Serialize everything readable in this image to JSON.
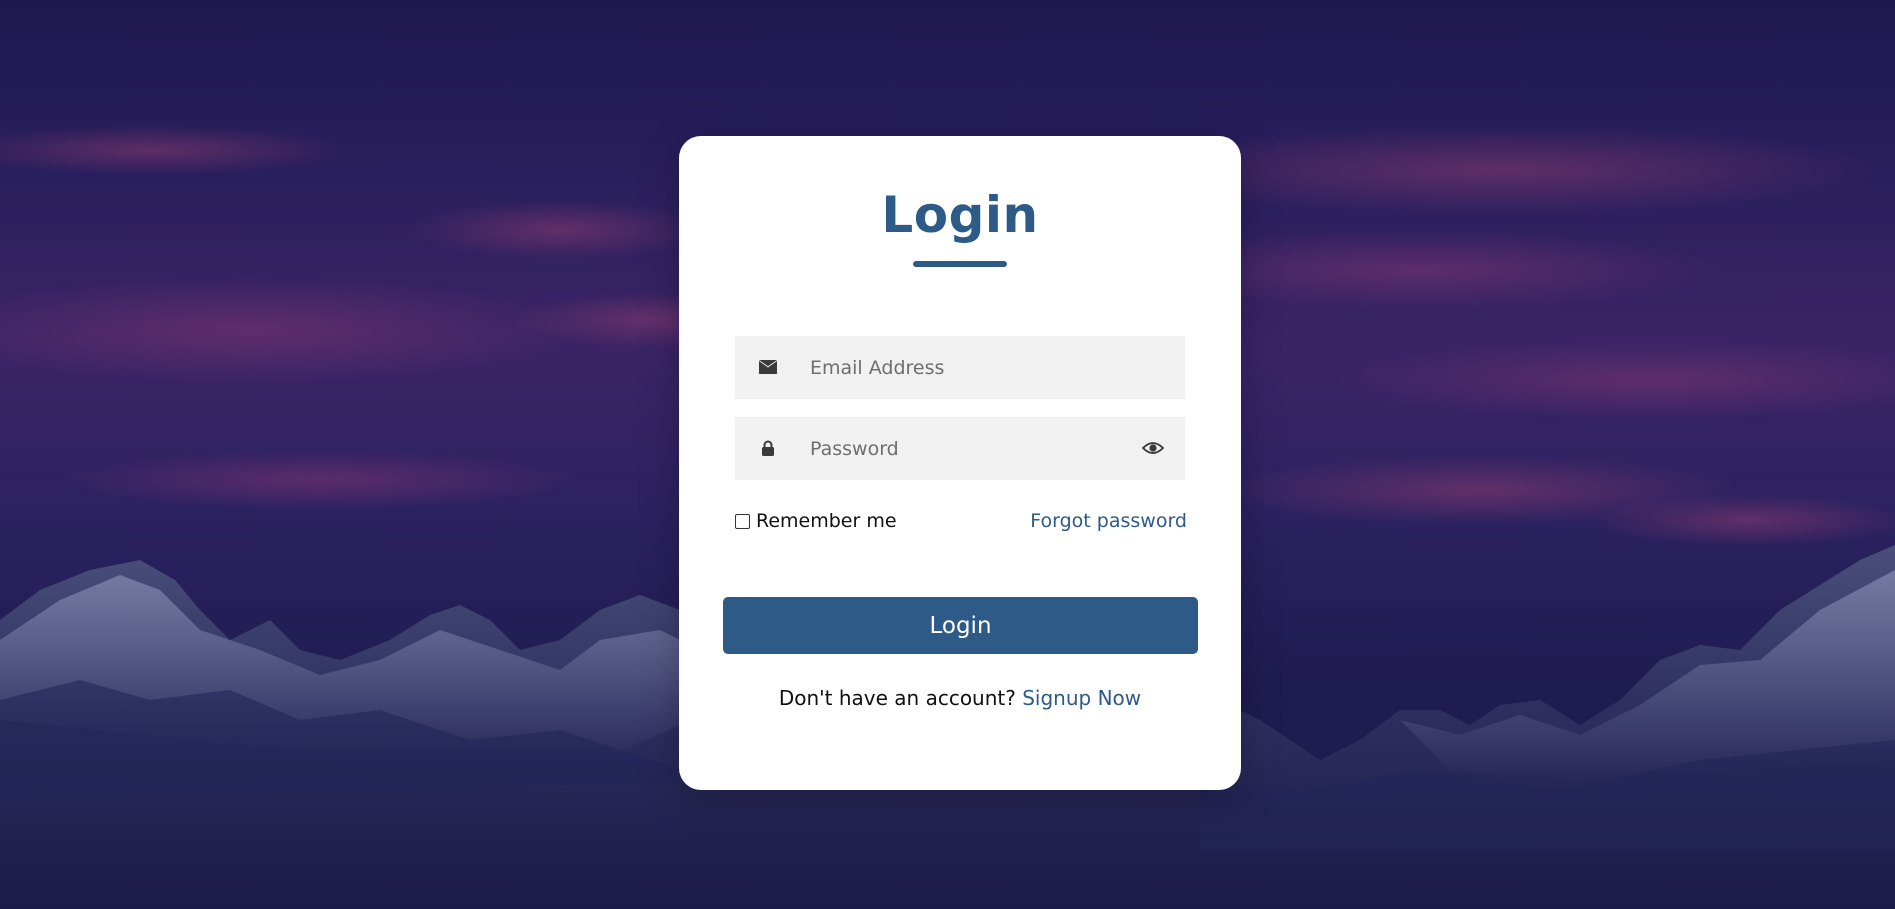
{
  "page": {
    "background_accent": "#3b2466"
  },
  "login_card": {
    "title": "Login",
    "accent_color": "#2e5a87",
    "email": {
      "icon": "envelope-icon",
      "placeholder": "Email Address",
      "value": ""
    },
    "password": {
      "icon": "lock-icon",
      "placeholder": "Password",
      "value": "",
      "toggle_icon": "eye-icon"
    },
    "remember_me": {
      "label": "Remember me",
      "checked": false
    },
    "forgot_password_label": "Forgot password",
    "login_button_label": "Login",
    "signup_prompt": "Don't have an account?",
    "signup_link_label": "Signup Now"
  }
}
